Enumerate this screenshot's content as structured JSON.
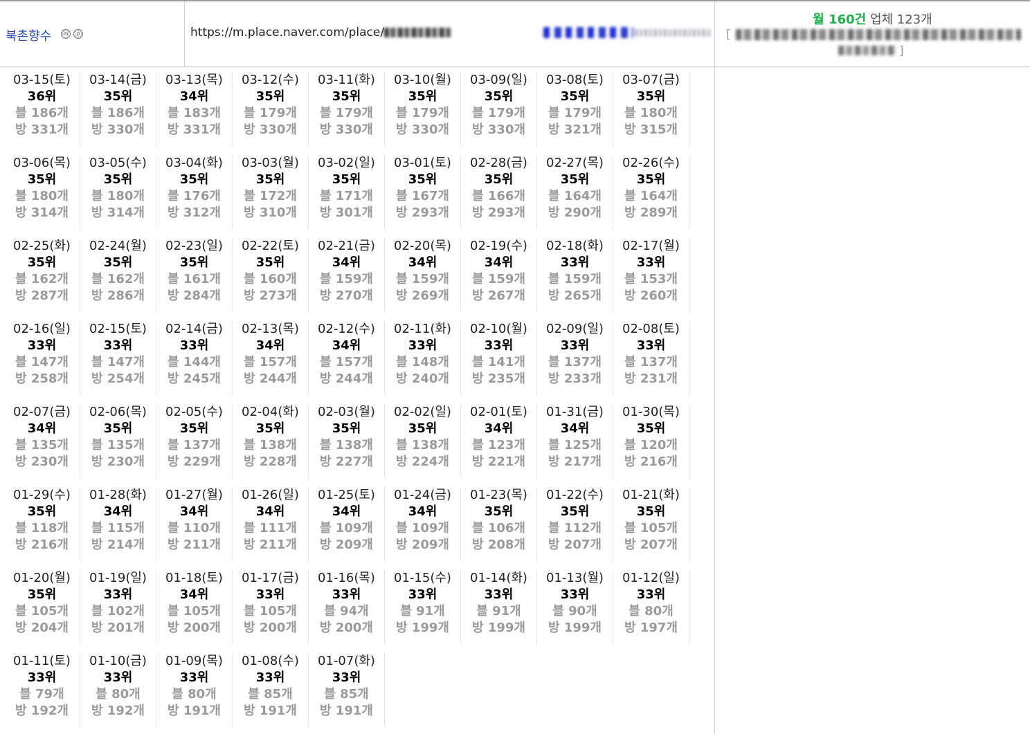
{
  "header": {
    "place_name": "북촌향수",
    "badge_m": "ⓜ",
    "badge_p": "ⓟ",
    "url": "https://m.place.naver.com/place/",
    "summary_month_label": "월 160건",
    "summary_company": "업체 123개",
    "bracket_open": "[",
    "bracket_close": "]"
  },
  "colors": {
    "link": "#2a4fb0",
    "green": "#1bb04a",
    "stat_gray": "#9a9a9a"
  },
  "labels": {
    "blog_prefix": "블",
    "visit_prefix": "방",
    "unit": "개",
    "rank_unit": "위"
  },
  "days": [
    {
      "date": "03-15(토)",
      "rank": "36위",
      "blog": "블 186개",
      "visit": "방 331개"
    },
    {
      "date": "03-14(금)",
      "rank": "35위",
      "blog": "블 186개",
      "visit": "방 330개"
    },
    {
      "date": "03-13(목)",
      "rank": "34위",
      "blog": "블 183개",
      "visit": "방 331개"
    },
    {
      "date": "03-12(수)",
      "rank": "35위",
      "blog": "블 179개",
      "visit": "방 330개"
    },
    {
      "date": "03-11(화)",
      "rank": "35위",
      "blog": "블 179개",
      "visit": "방 330개"
    },
    {
      "date": "03-10(월)",
      "rank": "35위",
      "blog": "블 179개",
      "visit": "방 330개"
    },
    {
      "date": "03-09(일)",
      "rank": "35위",
      "blog": "블 179개",
      "visit": "방 330개"
    },
    {
      "date": "03-08(토)",
      "rank": "35위",
      "blog": "블 179개",
      "visit": "방 321개"
    },
    {
      "date": "03-07(금)",
      "rank": "35위",
      "blog": "블 180개",
      "visit": "방 315개"
    },
    {
      "date": "03-06(목)",
      "rank": "35위",
      "blog": "블 180개",
      "visit": "방 314개"
    },
    {
      "date": "03-05(수)",
      "rank": "35위",
      "blog": "블 180개",
      "visit": "방 314개"
    },
    {
      "date": "03-04(화)",
      "rank": "35위",
      "blog": "블 176개",
      "visit": "방 312개"
    },
    {
      "date": "03-03(월)",
      "rank": "35위",
      "blog": "블 172개",
      "visit": "방 310개"
    },
    {
      "date": "03-02(일)",
      "rank": "35위",
      "blog": "블 171개",
      "visit": "방 301개"
    },
    {
      "date": "03-01(토)",
      "rank": "35위",
      "blog": "블 167개",
      "visit": "방 293개"
    },
    {
      "date": "02-28(금)",
      "rank": "35위",
      "blog": "블 166개",
      "visit": "방 293개"
    },
    {
      "date": "02-27(목)",
      "rank": "35위",
      "blog": "블 164개",
      "visit": "방 290개"
    },
    {
      "date": "02-26(수)",
      "rank": "35위",
      "blog": "블 164개",
      "visit": "방 289개"
    },
    {
      "date": "02-25(화)",
      "rank": "35위",
      "blog": "블 162개",
      "visit": "방 287개"
    },
    {
      "date": "02-24(월)",
      "rank": "35위",
      "blog": "블 162개",
      "visit": "방 286개"
    },
    {
      "date": "02-23(일)",
      "rank": "35위",
      "blog": "블 161개",
      "visit": "방 284개"
    },
    {
      "date": "02-22(토)",
      "rank": "35위",
      "blog": "블 160개",
      "visit": "방 273개"
    },
    {
      "date": "02-21(금)",
      "rank": "34위",
      "blog": "블 159개",
      "visit": "방 270개"
    },
    {
      "date": "02-20(목)",
      "rank": "34위",
      "blog": "블 159개",
      "visit": "방 269개"
    },
    {
      "date": "02-19(수)",
      "rank": "34위",
      "blog": "블 159개",
      "visit": "방 267개"
    },
    {
      "date": "02-18(화)",
      "rank": "33위",
      "blog": "블 159개",
      "visit": "방 265개"
    },
    {
      "date": "02-17(월)",
      "rank": "33위",
      "blog": "블 153개",
      "visit": "방 260개"
    },
    {
      "date": "02-16(일)",
      "rank": "33위",
      "blog": "블 147개",
      "visit": "방 258개"
    },
    {
      "date": "02-15(토)",
      "rank": "33위",
      "blog": "블 147개",
      "visit": "방 254개"
    },
    {
      "date": "02-14(금)",
      "rank": "33위",
      "blog": "블 144개",
      "visit": "방 245개"
    },
    {
      "date": "02-13(목)",
      "rank": "34위",
      "blog": "블 157개",
      "visit": "방 244개"
    },
    {
      "date": "02-12(수)",
      "rank": "34위",
      "blog": "블 157개",
      "visit": "방 244개"
    },
    {
      "date": "02-11(화)",
      "rank": "33위",
      "blog": "블 148개",
      "visit": "방 240개"
    },
    {
      "date": "02-10(월)",
      "rank": "33위",
      "blog": "블 141개",
      "visit": "방 235개"
    },
    {
      "date": "02-09(일)",
      "rank": "33위",
      "blog": "블 137개",
      "visit": "방 233개"
    },
    {
      "date": "02-08(토)",
      "rank": "33위",
      "blog": "블 137개",
      "visit": "방 231개"
    },
    {
      "date": "02-07(금)",
      "rank": "34위",
      "blog": "블 135개",
      "visit": "방 230개"
    },
    {
      "date": "02-06(목)",
      "rank": "35위",
      "blog": "블 135개",
      "visit": "방 230개"
    },
    {
      "date": "02-05(수)",
      "rank": "35위",
      "blog": "블 137개",
      "visit": "방 229개"
    },
    {
      "date": "02-04(화)",
      "rank": "35위",
      "blog": "블 138개",
      "visit": "방 228개"
    },
    {
      "date": "02-03(월)",
      "rank": "35위",
      "blog": "블 138개",
      "visit": "방 227개"
    },
    {
      "date": "02-02(일)",
      "rank": "35위",
      "blog": "블 138개",
      "visit": "방 224개"
    },
    {
      "date": "02-01(토)",
      "rank": "34위",
      "blog": "블 123개",
      "visit": "방 221개"
    },
    {
      "date": "01-31(금)",
      "rank": "34위",
      "blog": "블 125개",
      "visit": "방 217개"
    },
    {
      "date": "01-30(목)",
      "rank": "35위",
      "blog": "블 120개",
      "visit": "방 216개"
    },
    {
      "date": "01-29(수)",
      "rank": "35위",
      "blog": "블 118개",
      "visit": "방 216개"
    },
    {
      "date": "01-28(화)",
      "rank": "34위",
      "blog": "블 115개",
      "visit": "방 214개"
    },
    {
      "date": "01-27(월)",
      "rank": "34위",
      "blog": "블 110개",
      "visit": "방 211개"
    },
    {
      "date": "01-26(일)",
      "rank": "34위",
      "blog": "블 111개",
      "visit": "방 211개"
    },
    {
      "date": "01-25(토)",
      "rank": "34위",
      "blog": "블 109개",
      "visit": "방 209개"
    },
    {
      "date": "01-24(금)",
      "rank": "34위",
      "blog": "블 109개",
      "visit": "방 209개"
    },
    {
      "date": "01-23(목)",
      "rank": "35위",
      "blog": "블 106개",
      "visit": "방 208개"
    },
    {
      "date": "01-22(수)",
      "rank": "35위",
      "blog": "블 112개",
      "visit": "방 207개"
    },
    {
      "date": "01-21(화)",
      "rank": "35위",
      "blog": "블 105개",
      "visit": "방 207개"
    },
    {
      "date": "01-20(월)",
      "rank": "35위",
      "blog": "블 105개",
      "visit": "방 204개"
    },
    {
      "date": "01-19(일)",
      "rank": "33위",
      "blog": "블 102개",
      "visit": "방 201개"
    },
    {
      "date": "01-18(토)",
      "rank": "34위",
      "blog": "블 105개",
      "visit": "방 200개"
    },
    {
      "date": "01-17(금)",
      "rank": "33위",
      "blog": "블 105개",
      "visit": "방 200개"
    },
    {
      "date": "01-16(목)",
      "rank": "33위",
      "blog": "블 94개",
      "visit": "방 200개"
    },
    {
      "date": "01-15(수)",
      "rank": "33위",
      "blog": "블 91개",
      "visit": "방 199개"
    },
    {
      "date": "01-14(화)",
      "rank": "33위",
      "blog": "블 91개",
      "visit": "방 199개"
    },
    {
      "date": "01-13(월)",
      "rank": "33위",
      "blog": "블 90개",
      "visit": "방 199개"
    },
    {
      "date": "01-12(일)",
      "rank": "33위",
      "blog": "블 80개",
      "visit": "방 197개"
    },
    {
      "date": "01-11(토)",
      "rank": "33위",
      "blog": "블 79개",
      "visit": "방 192개"
    },
    {
      "date": "01-10(금)",
      "rank": "33위",
      "blog": "블 80개",
      "visit": "방 192개"
    },
    {
      "date": "01-09(목)",
      "rank": "33위",
      "blog": "블 80개",
      "visit": "방 191개"
    },
    {
      "date": "01-08(수)",
      "rank": "33위",
      "blog": "블 85개",
      "visit": "방 191개"
    },
    {
      "date": "01-07(화)",
      "rank": "33위",
      "blog": "블 85개",
      "visit": "방 191개"
    }
  ]
}
